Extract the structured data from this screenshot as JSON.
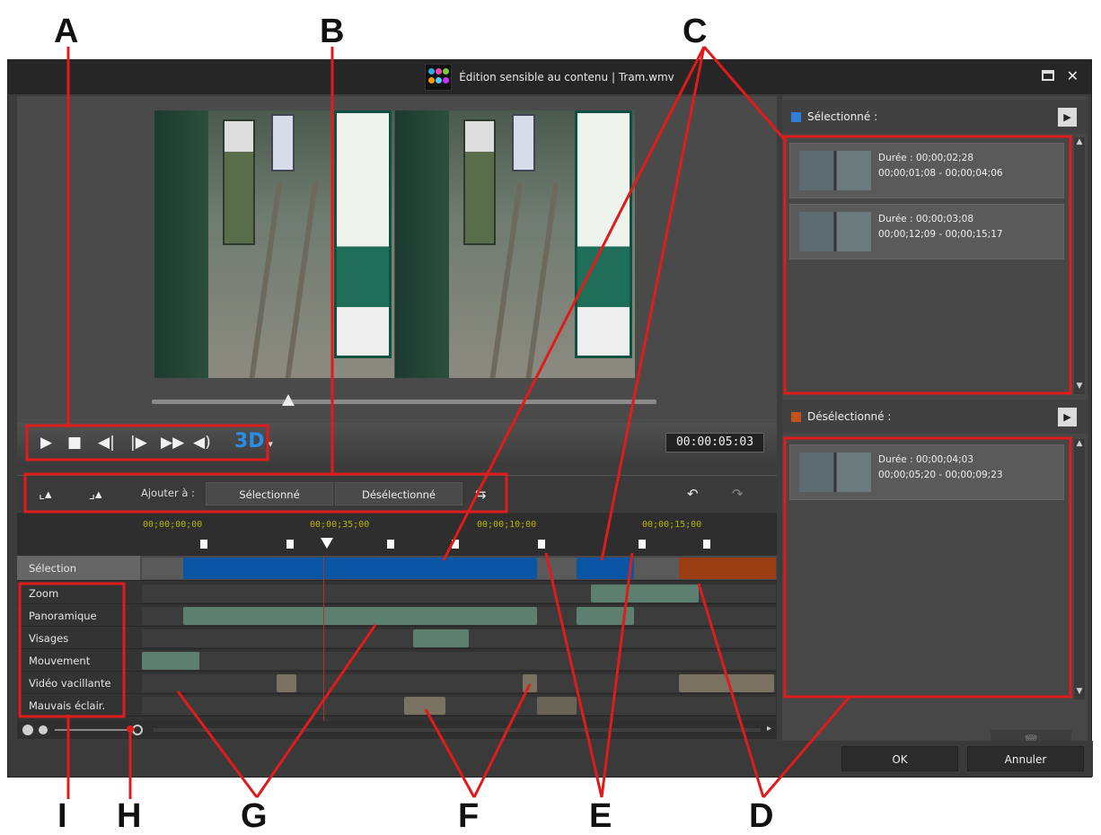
{
  "window": {
    "title": "Édition sensible au contenu  |  Tram.wmv"
  },
  "callouts": {
    "A": "A",
    "B": "B",
    "C": "C",
    "D": "D",
    "E": "E",
    "F": "F",
    "G": "G",
    "H": "H",
    "I": "I"
  },
  "player": {
    "timecode": "00:00:05:03",
    "btn_3d": "3D",
    "playback_position": 0.27
  },
  "toolbar": {
    "add_to_label": "Ajouter à :",
    "selected_btn": "Sélectionné",
    "deselected_btn": "Désélectionné"
  },
  "timeline": {
    "ticks": [
      "00;00;00;00",
      "00;00;35;00",
      "00;00;10;00",
      "00;00;15;00"
    ],
    "tracks": [
      {
        "label": "Sélection"
      },
      {
        "label": "Zoom"
      },
      {
        "label": "Panoramique"
      },
      {
        "label": "Visages"
      },
      {
        "label": "Mouvement"
      },
      {
        "label": "Vidéo vacillante"
      },
      {
        "label": "Mauvais éclair."
      }
    ]
  },
  "side": {
    "selected_title": "Sélectionné :",
    "deselected_title": "Désélectionné :",
    "selected_clips": [
      {
        "duration": "Durée : 00;00;02;28",
        "range": "00;00;01;08 - 00;00;04;06"
      },
      {
        "duration": "Durée : 00;00;03;08",
        "range": "00;00;12;09 - 00;00;15;17"
      }
    ],
    "deselected_clips": [
      {
        "duration": "Durée : 00;00;04;03",
        "range": "00;00;05;20 - 00;00;09;23"
      }
    ]
  },
  "footer": {
    "ok": "OK",
    "cancel": "Annuler"
  },
  "colors": {
    "selection_blue": "#0b56a4",
    "deselection_orange": "#9a3d12",
    "track_green": "#5d7f6f",
    "track_tan": "#7a7260",
    "callout_red": "#e01b1b"
  }
}
